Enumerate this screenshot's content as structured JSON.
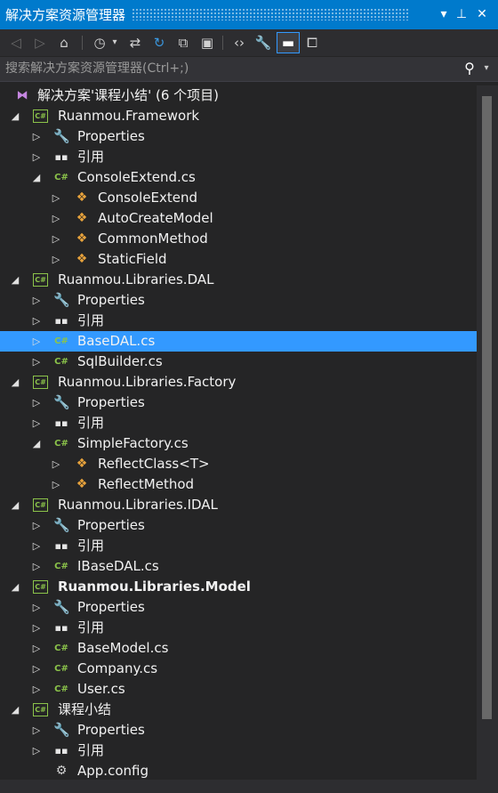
{
  "window": {
    "title": "解决方案资源管理器",
    "dropdown_glyph": "▾",
    "pin_glyph": "⊥",
    "close_glyph": "✕"
  },
  "toolbar": [
    {
      "name": "back-button",
      "icon": "back-icon",
      "glyph": "◁",
      "style": "dim"
    },
    {
      "name": "forward-button",
      "icon": "forward-icon",
      "glyph": "▷",
      "style": "dim"
    },
    {
      "name": "home-button",
      "icon": "home-icon",
      "glyph": "⌂",
      "style": "normal"
    },
    {
      "name": "pending-changes-button",
      "icon": "clock-icon",
      "glyph": "◷",
      "style": "normal"
    },
    {
      "name": "pending-changes-dropdown",
      "icon": "chevron-down-icon",
      "glyph": "▾",
      "style": "normal"
    },
    {
      "name": "sync-button",
      "icon": "sync-icon",
      "glyph": "⇄",
      "style": "normal"
    },
    {
      "name": "refresh-button",
      "icon": "refresh-icon",
      "glyph": "↻",
      "style": "blue"
    },
    {
      "name": "collapse-all-button",
      "icon": "collapse-all-icon",
      "glyph": "⧉",
      "style": "normal"
    },
    {
      "name": "show-all-files-button",
      "icon": "show-all-files-icon",
      "glyph": "▣",
      "style": "normal"
    },
    {
      "name": "view-code-button",
      "icon": "code-icon",
      "glyph": "‹›",
      "style": "normal"
    },
    {
      "name": "properties-button",
      "icon": "wrench-icon",
      "glyph": "🔧",
      "style": "normal"
    },
    {
      "name": "preview-button",
      "icon": "preview-icon",
      "glyph": "▬",
      "style": "active"
    },
    {
      "name": "class-view-button",
      "icon": "class-diagram-icon",
      "glyph": "⧠",
      "style": "normal"
    }
  ],
  "search": {
    "placeholder": "搜索解决方案资源管理器(Ctrl+;)",
    "value": "",
    "icon_glyph": "⚲",
    "dropdown_glyph": "▾"
  },
  "tree": [
    {
      "label": "解决方案'课程小结' (6 个项目)",
      "icon": "sln",
      "depth": 0,
      "expander": "none"
    },
    {
      "label": "Ruanmou.Framework",
      "icon": "proj",
      "depth": 0,
      "expander": "expanded"
    },
    {
      "label": "Properties",
      "icon": "wrench",
      "depth": 1,
      "expander": "collapsed"
    },
    {
      "label": "引用",
      "icon": "ref",
      "depth": 1,
      "expander": "collapsed"
    },
    {
      "label": "ConsoleExtend.cs",
      "icon": "cs",
      "depth": 1,
      "expander": "expanded"
    },
    {
      "label": "ConsoleExtend",
      "icon": "cls",
      "depth": 2,
      "expander": "collapsed"
    },
    {
      "label": "AutoCreateModel",
      "icon": "cls",
      "depth": 2,
      "expander": "collapsed"
    },
    {
      "label": "CommonMethod",
      "icon": "cls",
      "depth": 2,
      "expander": "collapsed"
    },
    {
      "label": "StaticField",
      "icon": "cls",
      "depth": 2,
      "expander": "collapsed"
    },
    {
      "label": "Ruanmou.Libraries.DAL",
      "icon": "proj",
      "depth": 0,
      "expander": "expanded"
    },
    {
      "label": "Properties",
      "icon": "wrench",
      "depth": 1,
      "expander": "collapsed"
    },
    {
      "label": "引用",
      "icon": "ref",
      "depth": 1,
      "expander": "collapsed"
    },
    {
      "label": "BaseDAL.cs",
      "icon": "cs",
      "depth": 1,
      "expander": "collapsed",
      "selected": true
    },
    {
      "label": "SqlBuilder.cs",
      "icon": "cs",
      "depth": 1,
      "expander": "collapsed"
    },
    {
      "label": "Ruanmou.Libraries.Factory",
      "icon": "proj",
      "depth": 0,
      "expander": "expanded"
    },
    {
      "label": "Properties",
      "icon": "wrench",
      "depth": 1,
      "expander": "collapsed"
    },
    {
      "label": "引用",
      "icon": "ref",
      "depth": 1,
      "expander": "collapsed"
    },
    {
      "label": "SimpleFactory.cs",
      "icon": "cs",
      "depth": 1,
      "expander": "expanded"
    },
    {
      "label": "ReflectClass<T>",
      "icon": "cls",
      "depth": 2,
      "expander": "collapsed"
    },
    {
      "label": "ReflectMethod",
      "icon": "cls",
      "depth": 2,
      "expander": "collapsed"
    },
    {
      "label": "Ruanmou.Libraries.IDAL",
      "icon": "proj",
      "depth": 0,
      "expander": "expanded"
    },
    {
      "label": "Properties",
      "icon": "wrench",
      "depth": 1,
      "expander": "collapsed"
    },
    {
      "label": "引用",
      "icon": "ref",
      "depth": 1,
      "expander": "collapsed"
    },
    {
      "label": "IBaseDAL.cs",
      "icon": "cs",
      "depth": 1,
      "expander": "collapsed"
    },
    {
      "label": "Ruanmou.Libraries.Model",
      "icon": "proj",
      "depth": 0,
      "expander": "expanded",
      "bold": true
    },
    {
      "label": "Properties",
      "icon": "wrench",
      "depth": 1,
      "expander": "collapsed"
    },
    {
      "label": "引用",
      "icon": "ref",
      "depth": 1,
      "expander": "collapsed"
    },
    {
      "label": "BaseModel.cs",
      "icon": "cs",
      "depth": 1,
      "expander": "collapsed"
    },
    {
      "label": "Company.cs",
      "icon": "cs",
      "depth": 1,
      "expander": "collapsed"
    },
    {
      "label": "User.cs",
      "icon": "cs",
      "depth": 1,
      "expander": "collapsed"
    },
    {
      "label": "课程小结",
      "icon": "proj",
      "depth": 0,
      "expander": "expanded"
    },
    {
      "label": "Properties",
      "icon": "wrench",
      "depth": 1,
      "expander": "collapsed"
    },
    {
      "label": "引用",
      "icon": "ref",
      "depth": 1,
      "expander": "collapsed"
    },
    {
      "label": "App.config",
      "icon": "cfg",
      "depth": 1,
      "expander": "none"
    }
  ],
  "icon_glyphs": {
    "sln": "⧓",
    "proj": "C#",
    "cs": "C#",
    "wrench": "🔧",
    "ref": "▪▪",
    "cls": "❖",
    "cfg": "⚙"
  },
  "icon_names": {
    "sln": "solution-icon",
    "proj": "csharp-project-icon",
    "cs": "csharp-file-icon",
    "wrench": "properties-wrench-icon",
    "ref": "references-icon",
    "cls": "class-icon",
    "cfg": "config-file-icon"
  },
  "expander_glyphs": {
    "expanded": "◢",
    "collapsed": "▷",
    "none": ""
  },
  "colors": {
    "accent": "#007acc",
    "selection": "#3399ff",
    "background": "#252526",
    "project_icon": "#8bc34a",
    "class_icon": "#e8a33c"
  }
}
